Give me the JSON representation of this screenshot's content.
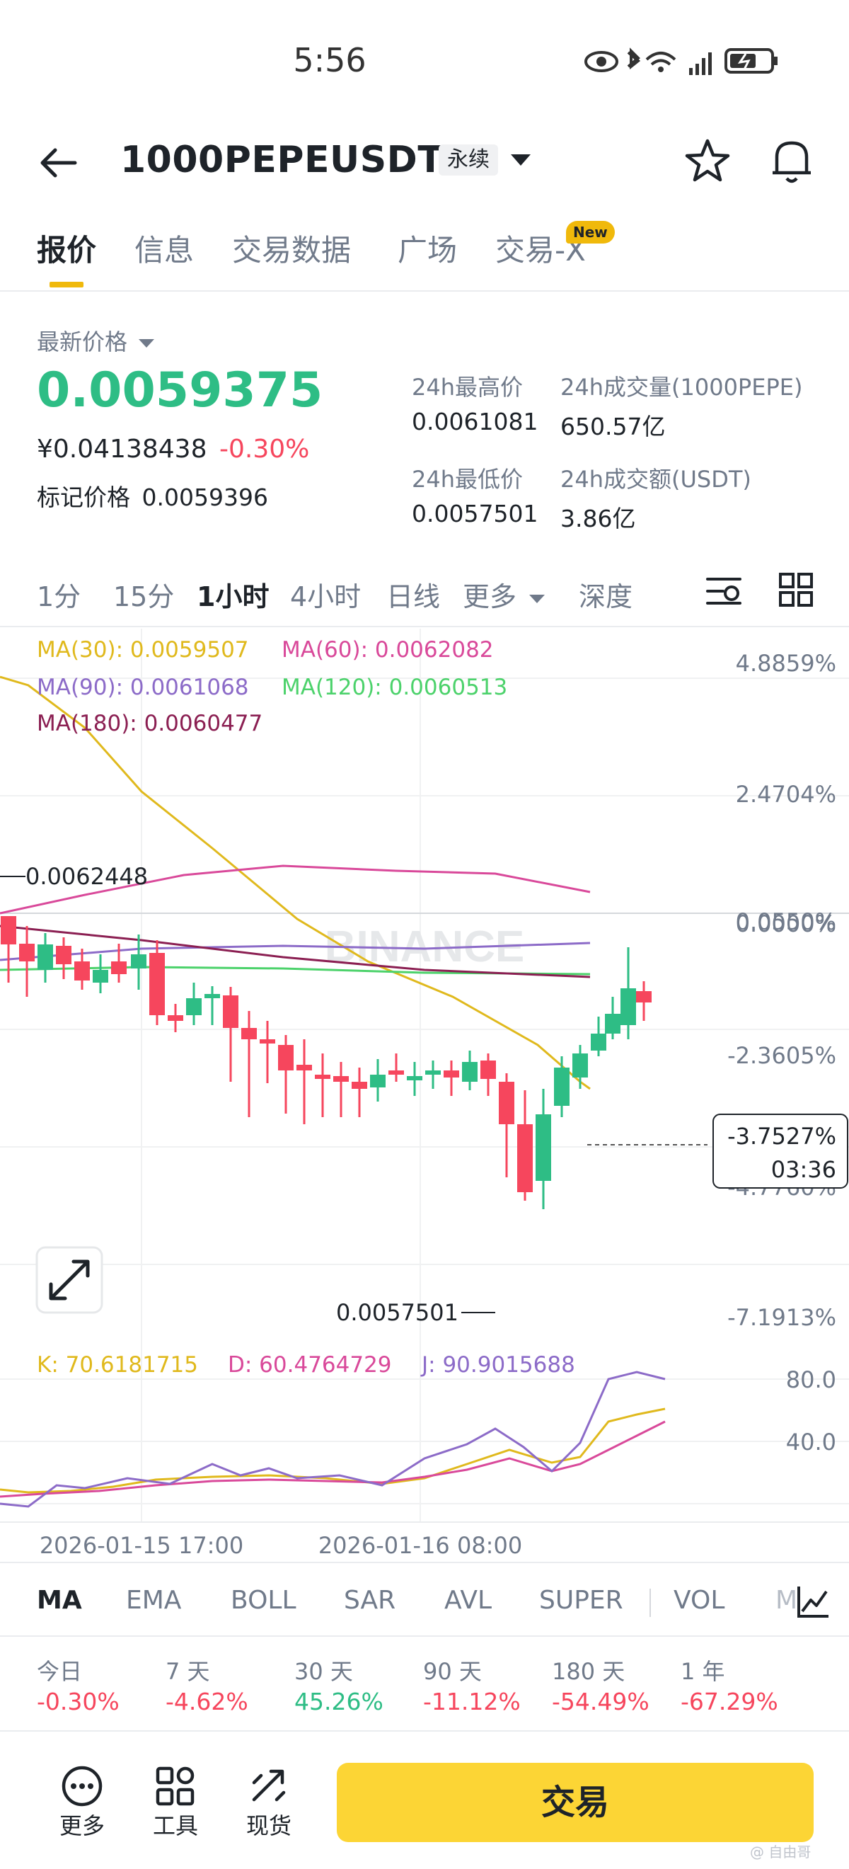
{
  "status_bar": {
    "time": "5:56"
  },
  "header": {
    "symbol": "1000PEPEUSDT",
    "contract_type": "永续"
  },
  "tabs": [
    {
      "label": "报价",
      "active": true
    },
    {
      "label": "信息"
    },
    {
      "label": "交易数据"
    },
    {
      "label": "广场"
    },
    {
      "label": "交易-X",
      "badge": "New"
    }
  ],
  "price": {
    "price_type_label": "最新价格",
    "last": "0.0059375",
    "cny": "¥0.04138438",
    "change_pct": "-0.30%",
    "mark_label": "标记价格",
    "mark_value": "0.0059396"
  },
  "stats": {
    "high_label": "24h最高价",
    "high": "0.0061081",
    "vol_label": "24h成交量(1000PEPE)",
    "vol": "650.57亿",
    "low_label": "24h最低价",
    "low": "0.0057501",
    "turnover_label": "24h成交额(USDT)",
    "turnover": "3.86亿"
  },
  "intervals": [
    {
      "label": "1分"
    },
    {
      "label": "15分"
    },
    {
      "label": "1小时",
      "active": true
    },
    {
      "label": "4小时"
    },
    {
      "label": "日线"
    },
    {
      "label": "更多"
    },
    {
      "label": "深度"
    }
  ],
  "ma_legend": {
    "ma30": "MA(30): 0.0059507",
    "ma60": "MA(60): 0.0062082",
    "ma90": "MA(90): 0.0061068",
    "ma120": "MA(120): 0.0060513",
    "ma180": "MA(180): 0.0060477"
  },
  "chart_data": {
    "type": "candlestick",
    "x_tick_labels": [
      "2026-01-15 17:00",
      "2026-01-16 08:00"
    ],
    "y_tick_labels": [
      "4.8859%",
      "2.4704%",
      "0.0550%",
      "0.0000%",
      "-2.3605%",
      "-4.7760%",
      "-7.1913%"
    ],
    "high_marker": "0.0062448",
    "low_marker": "0.0057501",
    "current_change": "-3.7527%",
    "countdown": "03:36",
    "watermark": "BINANCE",
    "kdj_legend": {
      "k": "K: 70.6181715",
      "d": "D: 60.4764729",
      "j": "J: 90.9015688"
    },
    "kdj_axis": [
      "80.0",
      "40.0"
    ],
    "colors": {
      "up": "#2ebd85",
      "down": "#f6465d",
      "ma30": "#e0b91d",
      "ma60": "#d9499a",
      "ma90": "#8c6bc8",
      "ma120": "#4cd26b",
      "ma180": "#8b1f52"
    }
  },
  "indicators": [
    "MA",
    "EMA",
    "BOLL",
    "SAR",
    "AVL",
    "SUPER",
    "VOL",
    "M"
  ],
  "performance": [
    {
      "label": "今日",
      "value": "-0.30%",
      "dir": "neg"
    },
    {
      "label": "7 天",
      "value": "-4.62%",
      "dir": "neg"
    },
    {
      "label": "30 天",
      "value": "45.26%",
      "dir": "pos"
    },
    {
      "label": "90 天",
      "value": "-11.12%",
      "dir": "neg"
    },
    {
      "label": "180 天",
      "value": "-54.49%",
      "dir": "neg"
    },
    {
      "label": "1 年",
      "value": "-67.29%",
      "dir": "neg"
    }
  ],
  "bottom": {
    "more": "更多",
    "tools": "工具",
    "spot": "现货",
    "trade": "交易"
  },
  "watermark_text": "@ 自由哥"
}
